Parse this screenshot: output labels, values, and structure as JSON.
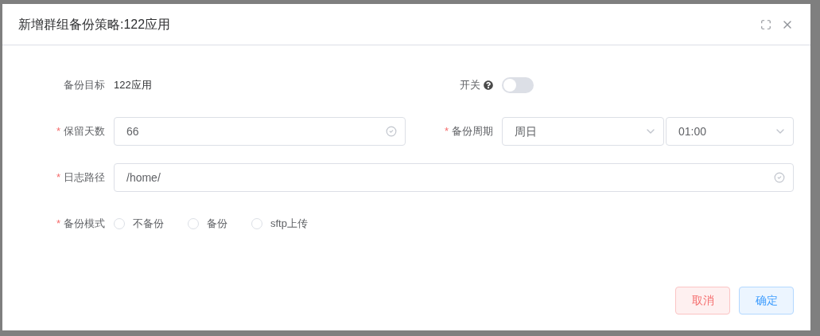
{
  "dialog": {
    "title": "新增群组备份策略:122应用",
    "target": {
      "label": "备份目标",
      "value": "122应用"
    },
    "switch": {
      "label": "开关",
      "on": false
    },
    "retention": {
      "label": "保留天数",
      "required_mark": "*",
      "value": "66"
    },
    "cycle": {
      "label": "备份周期",
      "required_mark": "*",
      "day": "周日",
      "time": "01:00"
    },
    "log_path": {
      "label": "日志路径",
      "required_mark": "*",
      "value": "/home/"
    },
    "mode": {
      "label": "备份模式",
      "required_mark": "*",
      "options": [
        {
          "label": "不备份",
          "selected": false
        },
        {
          "label": "备份",
          "selected": false
        },
        {
          "label": "sftp上传",
          "selected": false
        }
      ]
    },
    "buttons": [
      {
        "label": "取消",
        "kind": "cancel"
      },
      {
        "label": "确定",
        "kind": "confirm"
      }
    ]
  }
}
